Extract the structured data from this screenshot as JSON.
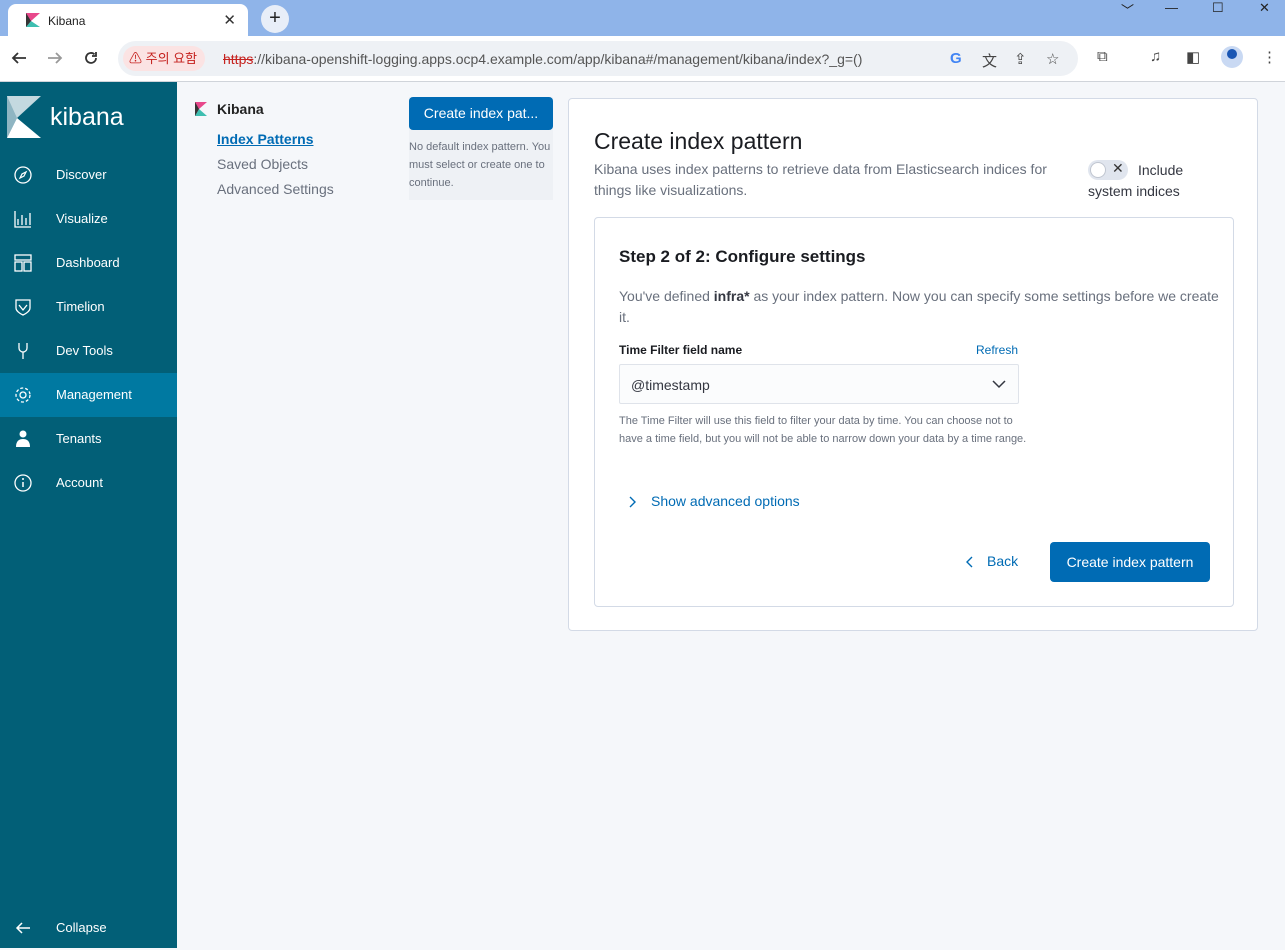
{
  "browser": {
    "tab_title": "Kibana",
    "tab_close": "✕",
    "new_tab": "+",
    "window_controls": [
      "﹀",
      "—",
      "☐",
      "✕"
    ],
    "security_warning": "⚠ 주의 요함",
    "url_scheme": "https",
    "url_rest": "://kibana-openshift-logging.apps.ocp4.example.com/app/kibana#/management/kibana/index?_g=()",
    "icons": [
      "back-icon",
      "forward-icon",
      "reload-icon",
      "google-icon",
      "translate-icon",
      "share-icon",
      "star-icon",
      "extensions-icon",
      "media-icon",
      "sidepanel-icon",
      "profile-icon",
      "menu-icon"
    ]
  },
  "sidenav": {
    "brand": "kibana",
    "items": [
      {
        "label": "Discover",
        "icon": "compass-icon"
      },
      {
        "label": "Visualize",
        "icon": "chart-icon"
      },
      {
        "label": "Dashboard",
        "icon": "dashboard-icon"
      },
      {
        "label": "Timelion",
        "icon": "shield-icon"
      },
      {
        "label": "Dev Tools",
        "icon": "wrench-icon"
      },
      {
        "label": "Management",
        "icon": "gear-icon",
        "active": true
      },
      {
        "label": "Tenants",
        "icon": "user-icon"
      },
      {
        "label": "Account",
        "icon": "info-icon"
      }
    ],
    "collapse": "Collapse"
  },
  "submenu": {
    "title": "Kibana",
    "items": [
      "Index Patterns",
      "Saved Objects",
      "Advanced Settings"
    ]
  },
  "index_list": {
    "button": "Create index pat...",
    "no_default": "No default index pattern. You must select or create one to continue."
  },
  "main": {
    "title": "Create index pattern",
    "description": "Kibana uses index patterns to retrieve data from Elasticsearch indices for things like visualizations.",
    "include_label": "Include system indices",
    "step_title": "Step 2 of 2: Configure settings",
    "step_desc_pre": "You've defined ",
    "step_desc_bold": "infra*",
    "step_desc_post": " as your index pattern. Now you can specify some settings before we create it.",
    "time_filter_label": "Time Filter field name",
    "refresh": "Refresh",
    "time_field": "@timestamp",
    "help_text": "The Time Filter will use this field to filter your data by time. You can choose not to have a time field, but you will not be able to narrow down your data by a time range.",
    "advanced": "Show advanced options",
    "back": "Back",
    "create": "Create index pattern"
  },
  "colors": {
    "sidenav": "#025f77",
    "active": "#0079a1",
    "primary": "#006bb4"
  }
}
